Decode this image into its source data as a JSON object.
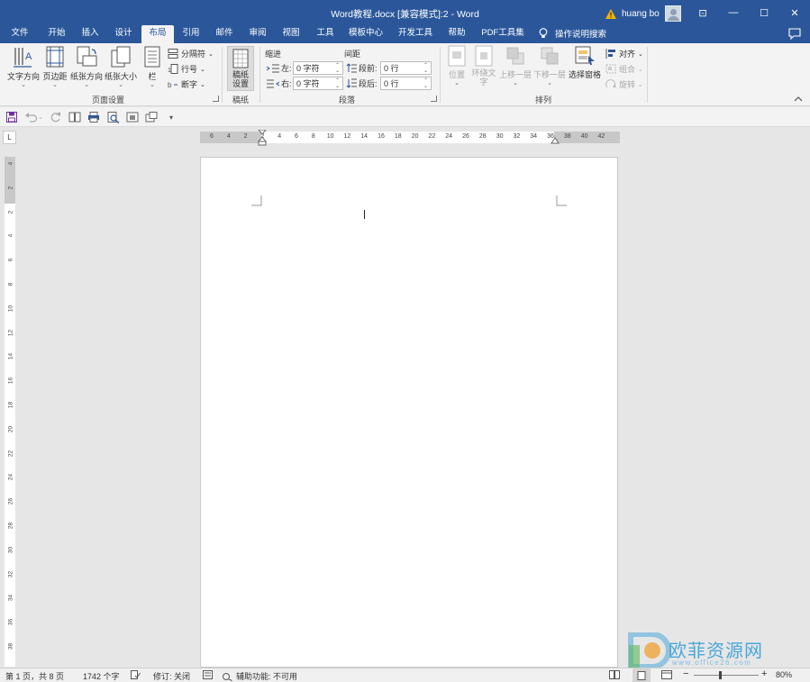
{
  "window": {
    "title": "Word教程.docx [兼容模式]:2  -  Word",
    "user": "huang bo",
    "buttons": {
      "ribbon_display": "⊡",
      "minimize": "—",
      "maximize": "☐",
      "close": "✕"
    }
  },
  "tabs": [
    {
      "label": "文件"
    },
    {
      "label": "开始"
    },
    {
      "label": "插入"
    },
    {
      "label": "设计"
    },
    {
      "label": "布局",
      "active": true
    },
    {
      "label": "引用"
    },
    {
      "label": "邮件"
    },
    {
      "label": "审阅"
    },
    {
      "label": "视图"
    },
    {
      "label": "工具"
    },
    {
      "label": "模板中心"
    },
    {
      "label": "开发工具"
    },
    {
      "label": "帮助"
    },
    {
      "label": "PDF工具集"
    }
  ],
  "help_search": "操作说明搜索",
  "ribbon": {
    "page_setup": {
      "label": "页面设置",
      "text_direction": "文字方向",
      "margins": "页边距",
      "orientation": "纸张方向",
      "size": "纸张大小",
      "columns": "栏",
      "breaks": "分隔符",
      "line_numbers": "行号",
      "hyphenation": "断字"
    },
    "manuscript": {
      "label": "稿纸",
      "button_line1": "稿纸",
      "button_line2": "设置"
    },
    "paragraph": {
      "label": "段落",
      "indent_title": "缩进",
      "spacing_title": "间距",
      "left_label": "左:",
      "right_label": "右:",
      "before_label": "段前:",
      "after_label": "段后:",
      "left_value": "0 字符",
      "right_value": "0 字符",
      "before_value": "0 行",
      "after_value": "0 行"
    },
    "arrange": {
      "label": "排列",
      "position": "位置",
      "wrap_line1": "环绕文",
      "wrap_line2": "字",
      "bring_forward": "上移一层",
      "send_backward": "下移一层",
      "selection_pane": "选择窗格",
      "align": "对齐",
      "group": "组合",
      "rotate": "旋转"
    }
  },
  "ruler": {
    "tab_selector": "L",
    "h_ticks": [
      "6",
      "4",
      "2",
      "2",
      "4",
      "6",
      "8",
      "10",
      "12",
      "14",
      "16",
      "18",
      "20",
      "22",
      "24",
      "26",
      "28",
      "30",
      "32",
      "34",
      "36",
      "38",
      "40",
      "42"
    ],
    "v_ticks": [
      "4",
      "2",
      "2",
      "4",
      "6",
      "8",
      "10",
      "12",
      "14",
      "16",
      "18",
      "20",
      "22",
      "24",
      "26",
      "28",
      "30",
      "32",
      "34",
      "36",
      "38"
    ]
  },
  "status": {
    "page": "第 1 页，共 8 页",
    "words": "1742 个字",
    "track_changes": "修订: 关闭",
    "accessibility": "辅助功能: 不可用",
    "zoom_minus": "−",
    "zoom_plus": "+",
    "zoom": "80%"
  },
  "watermark": {
    "text": "欧菲资源网",
    "url": "www.office26.com"
  },
  "colors": {
    "brand": "#2b579a",
    "ribbon_bg": "#f3f3f3",
    "workspace": "#e6e6e6"
  }
}
